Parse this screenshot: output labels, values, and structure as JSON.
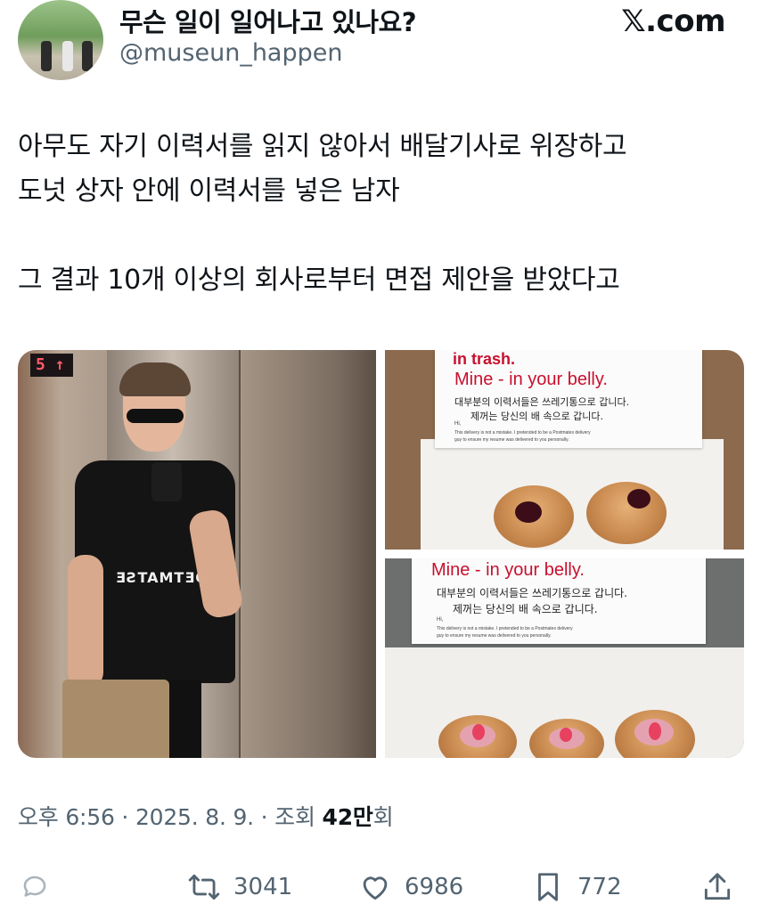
{
  "header": {
    "display_name": "무슨 일이 일어나고 있나요?",
    "handle": "@museun_happen",
    "brand": "𝕏.com"
  },
  "tweet": {
    "text": "아무도 자기 이력서를 읽지 않아서 배달기사로 위장하고\n도넛 상자 안에 이력서를 넣은 남자\n\n그 결과 10개 이상의 회사로부터 면접 제안을 받았다고"
  },
  "media": {
    "left_photo": {
      "floor_indicator": "5 ↑",
      "shirt_text": "ƎƧTAMTƎO"
    },
    "top_right_photo": {
      "heading": "in trash.",
      "subheading": "Mine - in your belly.",
      "korean_line1": "대부분의 이력서들은 쓰레기통으로 갑니다.",
      "korean_line2": "제꺼는 당신의 배 속으로 갑니다.",
      "greeting": "Hi,",
      "small_print1": "This delivery is not a mistake. I pretended to be a Postmates delivery",
      "small_print2": "guy to ensure my resume was delivered to you personally."
    },
    "bottom_right_photo": {
      "subheading": "Mine - in your belly.",
      "korean_line1": "대부분의 이력서들은 쓰레기통으로 갑니다.",
      "korean_line2": "제꺼는 당신의 배 속으로 갑니다.",
      "greeting": "Hi,",
      "small_print1": "This delivery is not a mistake. I pretended to be a Postmates delivery",
      "small_print2": "guy to ensure my resume was delivered to you personally."
    }
  },
  "meta": {
    "time": "오후 6:56",
    "sep1": " · ",
    "date": "2025. 8. 9.",
    "sep2": " · ",
    "views_label": "조회 ",
    "views_num": "42만",
    "views_suffix": "회"
  },
  "actions": {
    "reply_icon": "reply-icon",
    "retweet_icon": "retweet-icon",
    "retweet_count": "3041",
    "like_icon": "heart-icon",
    "like_count": "6986",
    "bookmark_icon": "bookmark-icon",
    "bookmark_count": "772",
    "share_icon": "share-icon"
  },
  "colors": {
    "text_primary": "#0f1419",
    "text_secondary": "#536471",
    "note_red": "#c8102e"
  }
}
